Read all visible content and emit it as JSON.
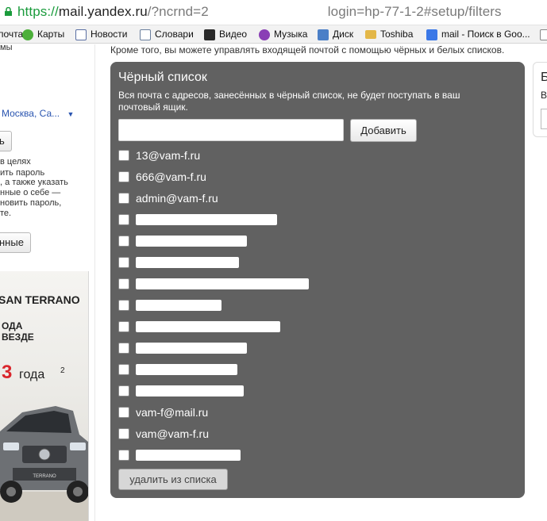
{
  "browser": {
    "url_scheme": "https://",
    "url_host": "mail.yandex.ru",
    "url_path_start": "/?ncrnd=2",
    "url_path_end": "login=hp-77-1-2#setup/filters"
  },
  "bookmarks": [
    {
      "label": "почта",
      "icon": "mail-icon",
      "color": "#d94a3a"
    },
    {
      "label": "Карты",
      "icon": "maps-icon",
      "color": "#4caf3a"
    },
    {
      "label": "Новости",
      "icon": "page-icon",
      "color": "#5a6fa3"
    },
    {
      "label": "Словари",
      "icon": "dictionary-icon",
      "color": "#6a7f9d"
    },
    {
      "label": "Видео",
      "icon": "video-icon",
      "color": "#2a2a2a"
    },
    {
      "label": "Музыка",
      "icon": "music-icon",
      "color": "#8a3fb5"
    },
    {
      "label": "Диск",
      "icon": "disk-icon",
      "color": "#4b7fc7"
    },
    {
      "label": "Toshiba",
      "icon": "folder-icon",
      "color": "#e3b748"
    },
    {
      "label": "mail - Поиск в Goo...",
      "icon": "google-icon",
      "color": "#3b78e7"
    }
  ],
  "sidebar": {
    "frag1": "мы",
    "location": "Москва, Са...",
    "btn1": "ь",
    "text_lines": [
      "в целях",
      "ить пароль",
      ", а также указать",
      "нные о себе —",
      "новить пароль,",
      "те."
    ],
    "btn2": "нные"
  },
  "ad": {
    "brand": "SAN TERRANO",
    "line1": "ОДА",
    "line2": "ВЕЗДЕ",
    "big": "3",
    "big_suffix": "года",
    "sup": "2",
    "car_label": "TERRANO"
  },
  "main": {
    "intro": "Кроме того, вы можете управлять входящей почтой с помощью чёрных и белых списков.",
    "blacklist": {
      "title": "Чёрный список",
      "description": "Вся почта с адресов, занесённых в чёрный список, не будет поступать в ваш почтовый ящик.",
      "add_button": "Добавить",
      "remove_button": "удалить из списка",
      "entries": [
        {
          "text": "13@vam-f.ru",
          "redacted": false
        },
        {
          "text": "666@vam-f.ru",
          "redacted": false
        },
        {
          "text": "admin@vam-f.ru",
          "redacted": false
        },
        {
          "text": "",
          "redacted": true
        },
        {
          "text": "",
          "redacted": true
        },
        {
          "text": "",
          "redacted": true
        },
        {
          "text": "",
          "redacted": true
        },
        {
          "text": "",
          "redacted": true
        },
        {
          "text": "",
          "redacted": true
        },
        {
          "text": "",
          "redacted": true
        },
        {
          "text": "",
          "redacted": true
        },
        {
          "text": "",
          "redacted": true
        },
        {
          "text": "vam-f@mail.ru",
          "redacted": false
        },
        {
          "text": "vam@vam-f.ru",
          "redacted": false
        },
        {
          "text": "",
          "redacted": true
        }
      ]
    }
  },
  "right_panel": {
    "title": "Б",
    "subtitle": "В"
  }
}
